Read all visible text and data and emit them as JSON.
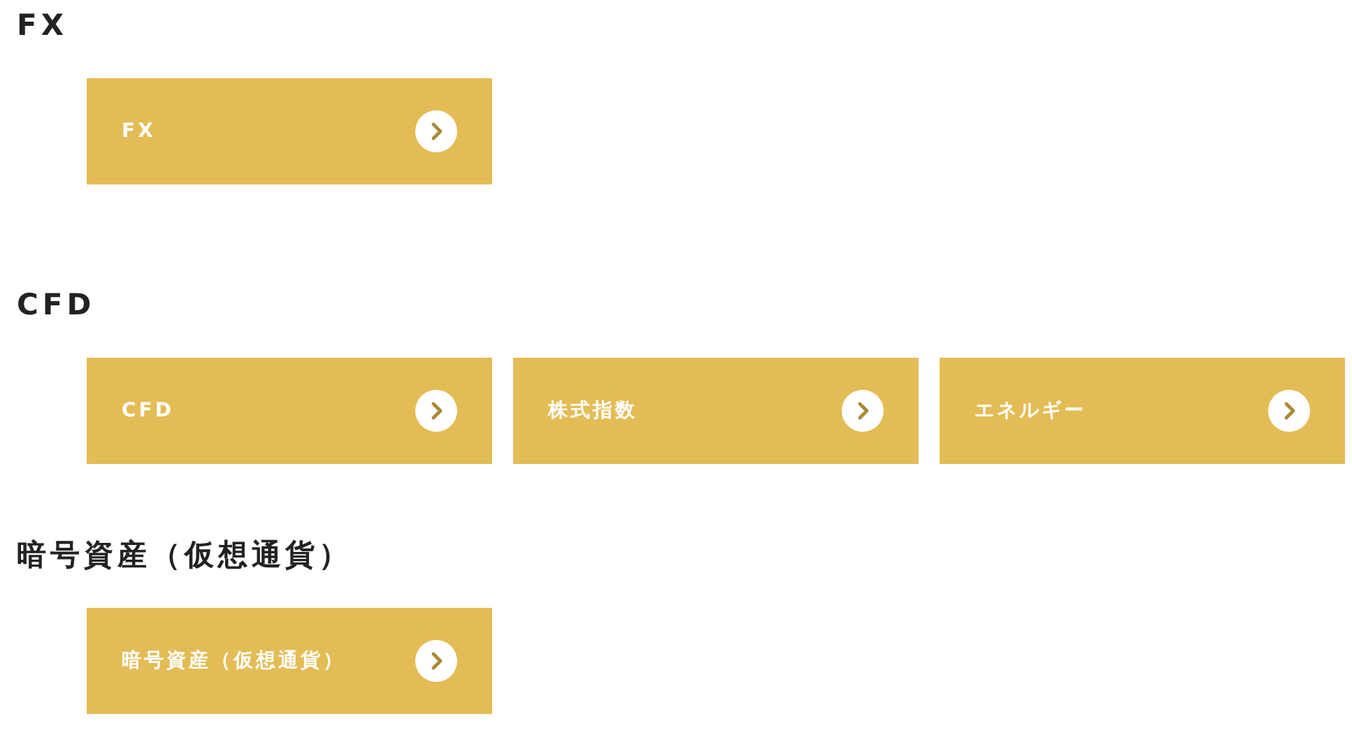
{
  "sections": [
    {
      "heading": "FX",
      "buttons": [
        {
          "label": "FX"
        }
      ]
    },
    {
      "heading": "CFD",
      "buttons": [
        {
          "label": "CFD"
        },
        {
          "label": "株式指数"
        },
        {
          "label": "エネルギー"
        }
      ]
    },
    {
      "heading": "暗号資産（仮想通貨）",
      "buttons": [
        {
          "label": "暗号資産（仮想通貨）"
        }
      ]
    }
  ]
}
